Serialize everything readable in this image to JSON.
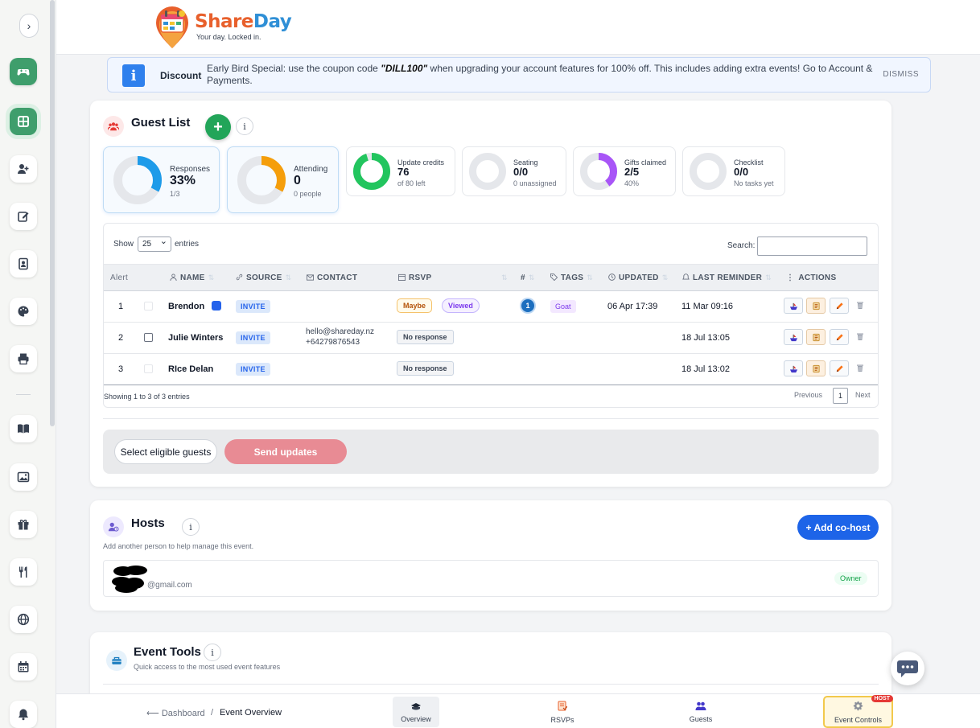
{
  "app": {
    "brand_share": "Share",
    "brand_day": "Day",
    "tagline": "Your day. Locked in."
  },
  "banner": {
    "title": "Discount",
    "text_before": "Early Bird Special: use the coupon code ",
    "code": "\"DILL100\"",
    "text_after": " when upgrading your account features for 100% off. This includes adding extra events! Go to Account & Payments.",
    "dismiss": "DISMISS"
  },
  "guest_list": {
    "title": "Guest List",
    "add_label": "+",
    "info_label": "i",
    "stats": [
      {
        "label": "Responses",
        "value": "33%",
        "sub": "1/3",
        "fraction": 0.33,
        "color": "#1e9be9"
      },
      {
        "label": "Attending",
        "value": "0",
        "sub": "0 people",
        "fraction": 0.33,
        "color": "#f59e0b"
      },
      {
        "label": "Update credits",
        "value": "76",
        "sub": "of 80 left",
        "fraction": 0.95,
        "color": "#22c55e"
      },
      {
        "label": "Seating",
        "value": "0/0",
        "sub": "0 unassigned",
        "fraction": 0,
        "color": "#9ca3af"
      },
      {
        "label": "Gifts claimed",
        "value": "2/5",
        "sub": "40%",
        "fraction": 0.4,
        "color": "#a855f7"
      },
      {
        "label": "Checklist",
        "value": "0/0",
        "sub": "No tasks yet",
        "fraction": 0,
        "color": "#9ca3af"
      }
    ],
    "table": {
      "show_label": "Show",
      "page_size": "25",
      "entries_label": "entries",
      "search_label": "Search:",
      "columns": [
        "Alert",
        "NAME",
        "SOURCE",
        "CONTACT",
        "RSVP",
        "#",
        "TAGS",
        "UPDATED",
        "LAST REMINDER",
        "ACTIONS"
      ],
      "rows": [
        {
          "index": "1",
          "name": "Brendon",
          "source": "INVITE",
          "email": "",
          "phone": "",
          "rsvp": "Maybe",
          "viewed": "Viewed",
          "count": "1",
          "tag": "Goat",
          "updated": "06 Apr 17:39",
          "last_reminder": "11 Mar 09:16"
        },
        {
          "index": "2",
          "name": "Julie Winters",
          "source": "INVITE",
          "email": "hello@shareday.nz",
          "phone": "+64279876543",
          "rsvp": "No response",
          "viewed": "",
          "count": "",
          "tag": "",
          "updated": "",
          "last_reminder": "18 Jul 13:05"
        },
        {
          "index": "3",
          "name": "RIce Delan",
          "source": "INVITE",
          "email": "",
          "phone": "",
          "rsvp": "No response",
          "viewed": "",
          "count": "",
          "tag": "",
          "updated": "",
          "last_reminder": "18 Jul 13:02"
        }
      ],
      "info": "Showing 1 to 3 of 3 entries",
      "prev": "Previous",
      "page": "1",
      "next": "Next"
    },
    "select_eligible": "Select eligible guests",
    "send_updates": "Send updates"
  },
  "hosts": {
    "title": "Hosts",
    "info_label": "i",
    "subtitle": "Add another person to help manage this event.",
    "add_cohost": "+ Add co-host",
    "host_email": "@gmail.com",
    "owner_badge": "Owner"
  },
  "event_tools": {
    "title": "Event Tools",
    "info_label": "i",
    "subtitle": "Quick access to the most used event features"
  },
  "bottom_nav": {
    "back": "⟵ Dashboard",
    "sep": "/",
    "current": "Event Overview",
    "items": [
      {
        "label": "Overview"
      },
      {
        "label": "RSVPs"
      },
      {
        "label": "Guests"
      },
      {
        "label": "Event Controls",
        "badge": "HOST"
      }
    ]
  },
  "sidebar": {
    "toggle": "›",
    "icons": [
      "gamepad-icon",
      "grid-icon",
      "add-user-icon",
      "edit-icon",
      "contact-card-icon",
      "palette-icon",
      "printer-icon",
      "book-icon",
      "image-icon",
      "gift-icon",
      "cutlery-icon",
      "globe-icon",
      "calendar-icon",
      "bell-icon"
    ]
  },
  "colors": {
    "brand_green": "#3f9e6c",
    "primary_blue": "#1d64e8",
    "send_pink": "#e88b94"
  }
}
